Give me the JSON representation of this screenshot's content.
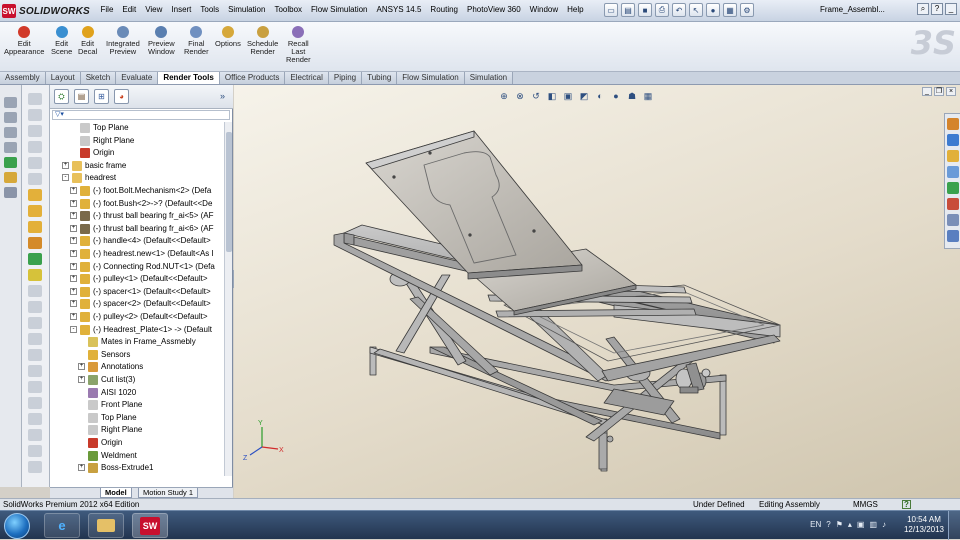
{
  "app": {
    "logo_text": "SOLIDWORKS",
    "document_title": "Frame_Assembl..."
  },
  "menu": [
    "File",
    "Edit",
    "View",
    "Insert",
    "Tools",
    "Simulation",
    "Toolbox",
    "Flow Simulation",
    "ANSYS 14.5",
    "Routing",
    "PhotoView 360",
    "Window",
    "Help"
  ],
  "command_manager": [
    {
      "label": "Edit\nAppearance",
      "icon": "appearance-icon",
      "color": "#d13a2a"
    },
    {
      "label": "Edit\nScene",
      "icon": "scene-icon",
      "color": "#3a8fd1"
    },
    {
      "label": "Edit\nDecal",
      "icon": "decal-icon",
      "color": "#e0a21c"
    },
    {
      "label": "Integrated\nPreview",
      "icon": "integrated-preview-icon",
      "color": "#6a8bb8"
    },
    {
      "label": "Preview\nWindow",
      "icon": "preview-window-icon",
      "color": "#5a7fb0"
    },
    {
      "label": "Final\nRender",
      "icon": "final-render-icon",
      "color": "#7090c0"
    },
    {
      "label": "Options",
      "icon": "options-icon",
      "color": "#d6a83a"
    },
    {
      "label": "Schedule\nRender",
      "icon": "schedule-render-icon",
      "color": "#c9a040"
    },
    {
      "label": "Recall\nLast\nRender",
      "icon": "recall-render-icon",
      "color": "#8a6fb8"
    }
  ],
  "tabs": [
    "Assembly",
    "Layout",
    "Sketch",
    "Evaluate",
    "Render Tools",
    "Office Products",
    "Electrical",
    "Piping",
    "Tubing",
    "Flow Simulation",
    "Simulation"
  ],
  "active_tab": "Render Tools",
  "tree": [
    {
      "label": "Top Plane",
      "icon": "plane-icon",
      "indent": 2,
      "expander": ""
    },
    {
      "label": "Right Plane",
      "icon": "plane-icon",
      "indent": 2,
      "expander": ""
    },
    {
      "label": "Origin",
      "icon": "origin-icon",
      "indent": 2,
      "expander": ""
    },
    {
      "label": "basic frame",
      "icon": "folder-icon",
      "indent": 1,
      "expander": "+"
    },
    {
      "label": "headrest",
      "icon": "folder-icon",
      "indent": 1,
      "expander": "-"
    },
    {
      "label": "(-) foot.Bolt.Mechanism<2> (Defa",
      "icon": "part-icon",
      "indent": 2,
      "expander": "+"
    },
    {
      "label": "(-) foot.Bush<2>->? (Default<<De",
      "icon": "part-icon",
      "indent": 2,
      "expander": "+"
    },
    {
      "label": "(-) thrust ball bearing fr_ai<5> (AF",
      "icon": "bearing-icon",
      "indent": 2,
      "expander": "+"
    },
    {
      "label": "(-) thrust ball bearing fr_ai<6> (AF",
      "icon": "bearing-icon",
      "indent": 2,
      "expander": "+"
    },
    {
      "label": "(-) handle<4> (Default<<Default>",
      "icon": "part-icon",
      "indent": 2,
      "expander": "+"
    },
    {
      "label": "(-) headrest.new<1> (Default<As I",
      "icon": "part-icon",
      "indent": 2,
      "expander": "+"
    },
    {
      "label": "(-) Connecting Rod.NUT<1> (Defa",
      "icon": "part-icon",
      "indent": 2,
      "expander": "+"
    },
    {
      "label": "(-) pulley<1> (Default<<Default>",
      "icon": "part-icon",
      "indent": 2,
      "expander": "+"
    },
    {
      "label": "(-) spacer<1> (Default<<Default>",
      "icon": "part-icon",
      "indent": 2,
      "expander": "+"
    },
    {
      "label": "(-) spacer<2> (Default<<Default>",
      "icon": "part-icon",
      "indent": 2,
      "expander": "+"
    },
    {
      "label": "(-) pulley<2> (Default<<Default>",
      "icon": "part-icon",
      "indent": 2,
      "expander": "+"
    },
    {
      "label": "(-) Headrest_Plate<1> -> (Default",
      "icon": "part-icon",
      "indent": 2,
      "expander": "-"
    },
    {
      "label": "Mates in Frame_Assmebly",
      "icon": "mates-icon",
      "indent": 3,
      "expander": ""
    },
    {
      "label": "Sensors",
      "icon": "sensors-icon",
      "indent": 3,
      "expander": ""
    },
    {
      "label": "Annotations",
      "icon": "annotations-icon",
      "indent": 3,
      "expander": "+"
    },
    {
      "label": "Cut list(3)",
      "icon": "cut-list-icon",
      "indent": 3,
      "expander": "+"
    },
    {
      "label": "AISI 1020",
      "icon": "material-icon",
      "indent": 3,
      "expander": ""
    },
    {
      "label": "Front Plane",
      "icon": "plane-icon",
      "indent": 3,
      "expander": ""
    },
    {
      "label": "Top Plane",
      "icon": "plane-icon",
      "indent": 3,
      "expander": ""
    },
    {
      "label": "Right Plane",
      "icon": "plane-icon",
      "indent": 3,
      "expander": ""
    },
    {
      "label": "Origin",
      "icon": "origin-icon",
      "indent": 3,
      "expander": ""
    },
    {
      "label": "Weldment",
      "icon": "weldment-icon",
      "indent": 3,
      "expander": ""
    },
    {
      "label": "Boss-Extrude1",
      "icon": "extrude-icon",
      "indent": 3,
      "expander": "+"
    }
  ],
  "bottom_tabs": [
    "Model",
    "Motion Study 1"
  ],
  "status": {
    "edition": "SolidWorks Premium 2012 x64 Edition",
    "state": "Under Defined",
    "mode": "Editing Assembly",
    "units": "MMGS",
    "help": "?"
  },
  "taskbar": {
    "language": "EN",
    "time": "10:54 AM",
    "date": "12/13/2013"
  },
  "colors": {
    "accent": "#2e5a96",
    "model_gray": "#b8b8b8",
    "model_edge": "#3a3a3a"
  }
}
